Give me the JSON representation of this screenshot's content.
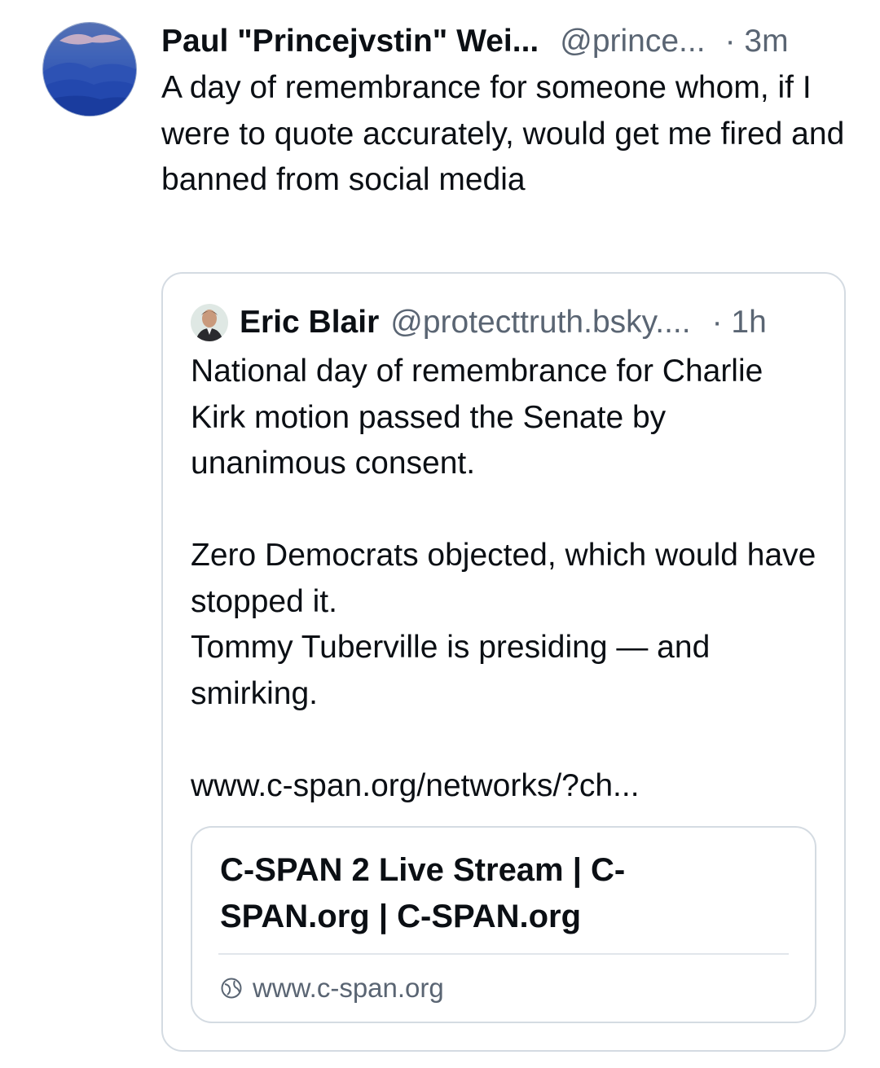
{
  "post": {
    "author": {
      "display_name": "Paul \"Princejvstin\" Wei...",
      "handle": "@prince...",
      "avatar": "mountain-landscape-avatar"
    },
    "time": "· 3m",
    "text": "A day of remembrance for someone whom, if I were to quote accurately, would get me fired and banned from social media"
  },
  "quote": {
    "author": {
      "display_name": "Eric Blair",
      "handle": "@protecttruth.bsky....",
      "avatar": "portrait-avatar"
    },
    "time": "· 1h",
    "text": "National day of remembrance for Charlie Kirk motion passed the Senate by unanimous consent.\n\nZero Democrats objected, which would have stopped it.\nTommy Tuberville is presiding — and smirking.\n\nwww.c-span.org/networks/?ch...",
    "link_card": {
      "title": "C-SPAN 2 Live Stream | C-SPAN.org | C-SPAN.org",
      "domain": "www.c-span.org",
      "icon": "globe-icon"
    }
  },
  "colors": {
    "text": "#0b0f14",
    "muted": "#5a6573",
    "border": "#d4dbe2"
  }
}
